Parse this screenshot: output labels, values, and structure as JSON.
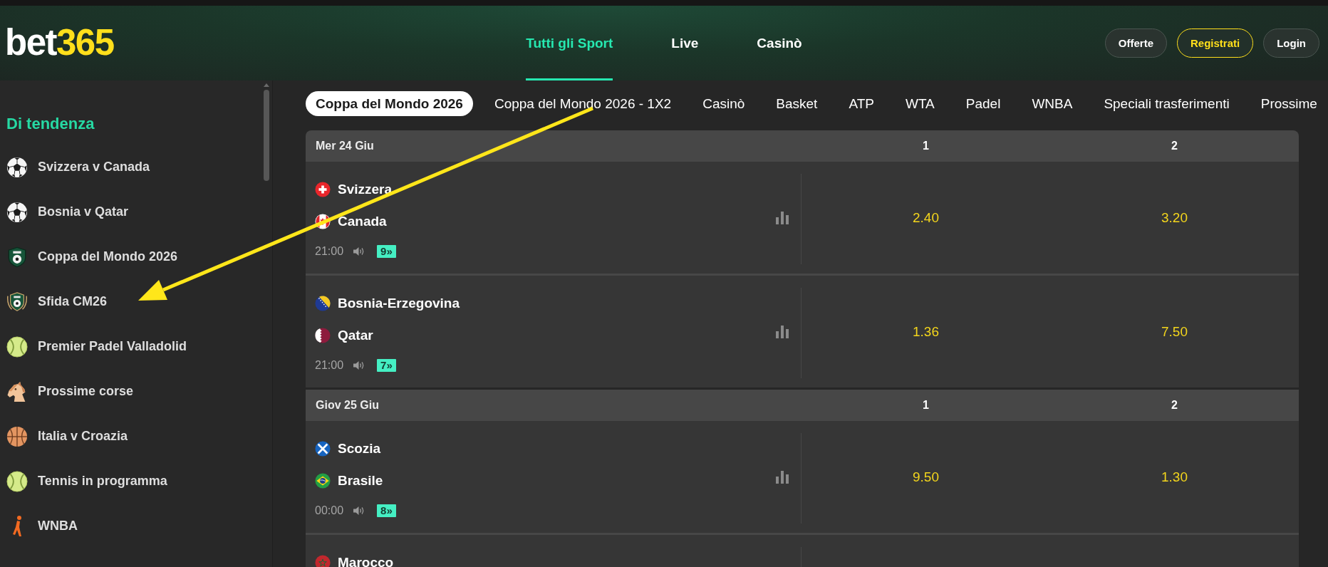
{
  "logo": {
    "word": "bet",
    "digits": "365"
  },
  "nav": [
    {
      "label": "Tutti gli Sport",
      "selected": true
    },
    {
      "label": "Live",
      "selected": false
    },
    {
      "label": "Casinò",
      "selected": false
    }
  ],
  "header_buttons": [
    {
      "label": "Offerte",
      "kind": "plain"
    },
    {
      "label": "Registrati",
      "kind": "highlight"
    },
    {
      "label": "Login",
      "kind": "plain"
    }
  ],
  "sidebar": {
    "heading": "Di tendenza",
    "items": [
      {
        "label": "Svizzera v Canada",
        "kind": "football"
      },
      {
        "label": "Bosnia v Qatar",
        "kind": "football"
      },
      {
        "label": "Coppa del Mondo 2026",
        "kind": "competition"
      },
      {
        "label": "Sfida CM26",
        "kind": "challenge"
      },
      {
        "label": "Premier Padel Valladolid",
        "kind": "padel"
      },
      {
        "label": "Prossime corse",
        "kind": "racing"
      },
      {
        "label": "Italia v Croazia",
        "kind": "basketball"
      },
      {
        "label": "Tennis in programma",
        "kind": "tennis"
      },
      {
        "label": "WNBA",
        "kind": "wnba"
      }
    ]
  },
  "tabs": [
    {
      "label": "Coppa del Mondo 2026",
      "selected": true
    },
    {
      "label": "Coppa del Mondo 2026 - 1X2",
      "selected": false
    },
    {
      "label": "Casinò",
      "selected": false
    },
    {
      "label": "Basket",
      "selected": false
    },
    {
      "label": "ATP",
      "selected": false
    },
    {
      "label": "WTA",
      "selected": false
    },
    {
      "label": "Padel",
      "selected": false
    },
    {
      "label": "WNBA",
      "selected": false
    },
    {
      "label": "Speciali trasferimenti",
      "selected": false
    },
    {
      "label": "Prossime",
      "selected": false
    }
  ],
  "groups": [
    {
      "date": "Mer 24 Giu",
      "columns": [
        "1",
        "2"
      ],
      "events": [
        {
          "teams": [
            {
              "name": "Svizzera",
              "kind": "switzerland"
            },
            {
              "name": "Canada",
              "kind": "canada"
            }
          ],
          "time": "21:00",
          "markets": "9»",
          "odds": [
            "2.40",
            "3.20"
          ]
        },
        {
          "teams": [
            {
              "name": "Bosnia-Erzegovina",
              "kind": "bosnia"
            },
            {
              "name": "Qatar",
              "kind": "qatar"
            }
          ],
          "time": "21:00",
          "markets": "7»",
          "odds": [
            "1.36",
            "7.50"
          ]
        }
      ]
    },
    {
      "date": "Giov 25 Giu",
      "columns": [
        "1",
        "2"
      ],
      "events": [
        {
          "teams": [
            {
              "name": "Scozia",
              "kind": "scotland"
            },
            {
              "name": "Brasile",
              "kind": "brazil"
            }
          ],
          "time": "00:00",
          "markets": "8»",
          "odds": [
            "9.50",
            "1.30"
          ]
        },
        {
          "teams": [
            {
              "name": "Marocco",
              "kind": "morocco"
            }
          ]
        }
      ]
    }
  ]
}
